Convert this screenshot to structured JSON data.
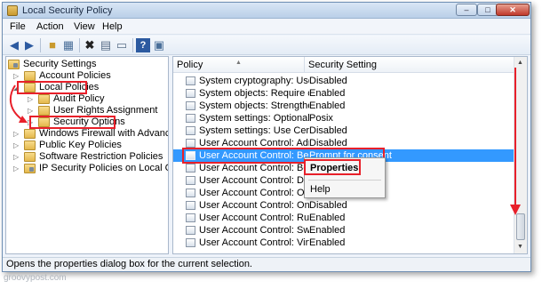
{
  "window": {
    "title": "Local Security Policy"
  },
  "menu": [
    "File",
    "Action",
    "View",
    "Help"
  ],
  "toolbar_icons": [
    "back-arrow-icon",
    "forward-arrow-icon",
    "up-folder-icon",
    "show-tree-icon",
    "delete-icon",
    "properties-icon",
    "export-icon",
    "help-icon",
    "console-icon"
  ],
  "tree": {
    "root": "Security Settings",
    "items": [
      {
        "label": "Account Policies",
        "level": 1
      },
      {
        "label": "Local Policies",
        "level": 1
      },
      {
        "label": "Audit Policy",
        "level": 2
      },
      {
        "label": "User Rights Assignment",
        "level": 2
      },
      {
        "label": "Security Options",
        "level": 2
      },
      {
        "label": "Windows Firewall with Advanced Secu",
        "level": 1
      },
      {
        "label": "Public Key Policies",
        "level": 1
      },
      {
        "label": "Software Restriction Policies",
        "level": 1
      },
      {
        "label": "IP Security Policies on Local Compute",
        "level": 1
      }
    ]
  },
  "list": {
    "columns": [
      "Policy",
      "Security Setting"
    ],
    "rows": [
      {
        "policy": "System cryptography: Use FIPS ...",
        "setting": "Disabled"
      },
      {
        "policy": "System objects: Require case in...",
        "setting": "Enabled"
      },
      {
        "policy": "System objects: Strengthen def...",
        "setting": "Enabled"
      },
      {
        "policy": "System settings: Optional subsy...",
        "setting": "Posix"
      },
      {
        "policy": "System settings: Use Certificate ...",
        "setting": "Disabled"
      },
      {
        "policy": "User Account Control: Admin A...",
        "setting": "Disabled"
      },
      {
        "policy": "User Account Control: Behavior...",
        "setting": "Prompt for consent"
      },
      {
        "policy": "User Account Control: Beh",
        "setting": ""
      },
      {
        "policy": "User Account Control: Dete",
        "setting": ""
      },
      {
        "policy": "User Account Control: Only",
        "setting": ""
      },
      {
        "policy": "User Account Control: Only ele...",
        "setting": "Disabled"
      },
      {
        "policy": "User Account Control: Run all a...",
        "setting": "Enabled"
      },
      {
        "policy": "User Account Control: Switch t...",
        "setting": "Enabled"
      },
      {
        "policy": "User Account Control: Virtualiz...",
        "setting": "Enabled"
      }
    ]
  },
  "context_menu": {
    "items": [
      "Properties",
      "Help"
    ]
  },
  "status": "Opens the properties dialog box for the current selection.",
  "watermark": "groovypost.com",
  "colors": {
    "highlight_red": "#e8202a",
    "selection_blue": "#3399ff"
  }
}
